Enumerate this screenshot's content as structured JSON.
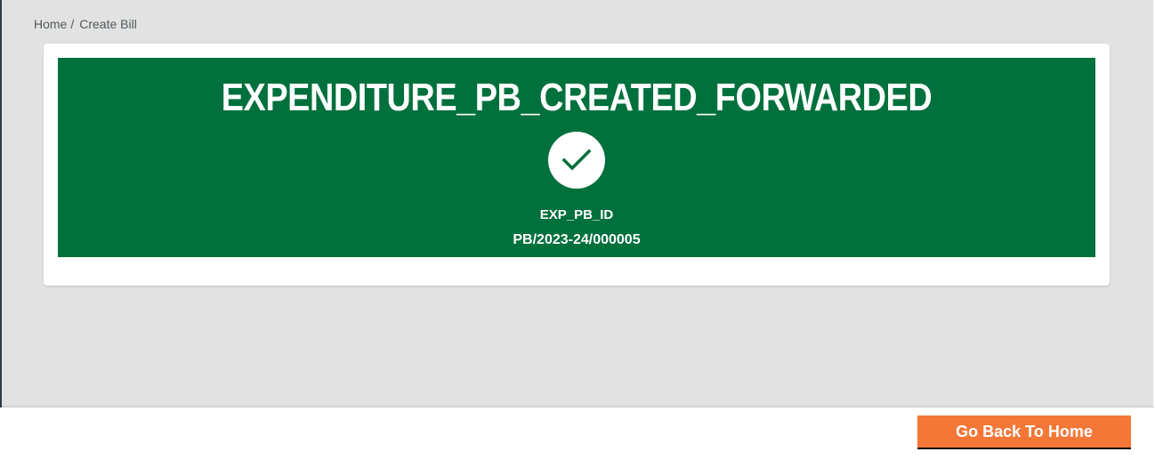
{
  "breadcrumb": {
    "home": "Home",
    "separator": "/",
    "current": "Create Bill"
  },
  "banner": {
    "title": "EXPENDITURE_PB_CREATED_FORWARDED",
    "status_icon": "check-icon",
    "id_label": "EXP_PB_ID",
    "id_value": "PB/2023-24/000005",
    "background_color": "#00703c"
  },
  "footer": {
    "go_back_label": "Go Back To Home",
    "button_color": "#f47738"
  }
}
